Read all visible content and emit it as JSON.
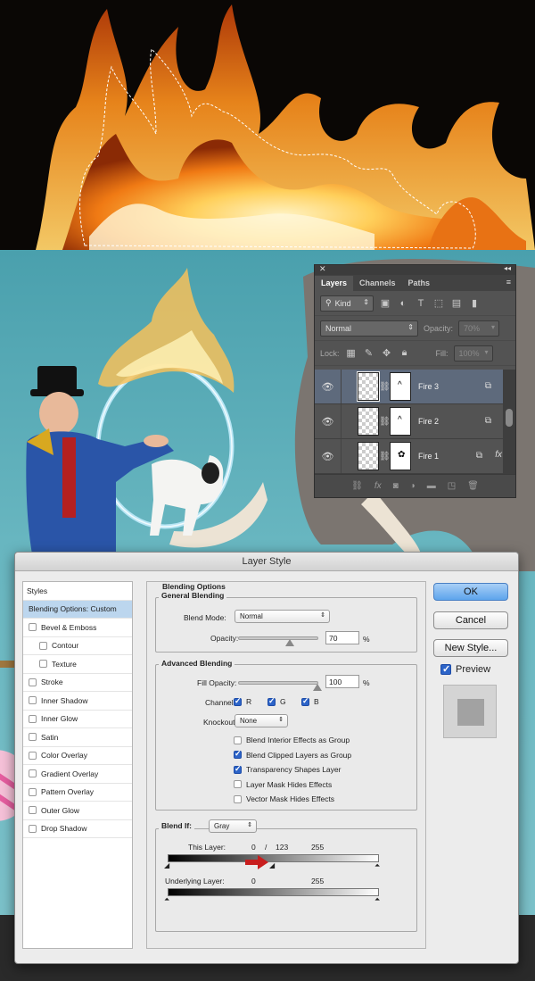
{
  "layers_panel": {
    "tabs": [
      "Layers",
      "Channels",
      "Paths"
    ],
    "filter_kind": "Kind",
    "blend_mode": "Normal",
    "opacity_label": "Opacity:",
    "opacity_value": "70%",
    "lock_label": "Lock:",
    "fill_label": "Fill:",
    "fill_value": "100%",
    "layers": [
      {
        "name": "Fire 3",
        "selected": true
      },
      {
        "name": "Fire 2",
        "selected": false
      },
      {
        "name": "Fire 1",
        "selected": false,
        "fx": "fx"
      }
    ]
  },
  "dialog": {
    "title": "Layer Style",
    "styles": {
      "header": "Styles",
      "selected": "Blending Options: Custom",
      "items": [
        {
          "label": "Bevel & Emboss",
          "sub": false
        },
        {
          "label": "Contour",
          "sub": true
        },
        {
          "label": "Texture",
          "sub": true
        },
        {
          "label": "Stroke",
          "sub": false
        },
        {
          "label": "Inner Shadow",
          "sub": false
        },
        {
          "label": "Inner Glow",
          "sub": false
        },
        {
          "label": "Satin",
          "sub": false
        },
        {
          "label": "Color Overlay",
          "sub": false
        },
        {
          "label": "Gradient Overlay",
          "sub": false
        },
        {
          "label": "Pattern Overlay",
          "sub": false
        },
        {
          "label": "Outer Glow",
          "sub": false
        },
        {
          "label": "Drop Shadow",
          "sub": false
        }
      ]
    },
    "blending": {
      "title": "Blending Options",
      "general_title": "General Blending",
      "blend_mode_label": "Blend Mode:",
      "blend_mode": "Normal",
      "opacity_label": "Opacity:",
      "opacity": "70",
      "opacity_pct": 70,
      "advanced_title": "Advanced Blending",
      "fill_opacity_label": "Fill Opacity:",
      "fill_opacity": "100",
      "fill_opacity_pct": 100,
      "pct_sign": "%",
      "channels_label": "Channels:",
      "channels": [
        "R",
        "G",
        "B"
      ],
      "knockout_label": "Knockout:",
      "knockout": "None",
      "options": [
        {
          "label": "Blend Interior Effects as Group",
          "checked": false
        },
        {
          "label": "Blend Clipped Layers as Group",
          "checked": true
        },
        {
          "label": "Transparency Shapes Layer",
          "checked": true
        },
        {
          "label": "Layer Mask Hides Effects",
          "checked": false
        },
        {
          "label": "Vector Mask Hides Effects",
          "checked": false
        }
      ],
      "blend_if_label": "Blend If:",
      "blend_if": "Gray",
      "this_layer_label": "This Layer:",
      "this_layer_low": "0",
      "this_layer_sep": "/",
      "this_layer_mid": "123",
      "this_layer_high": "255",
      "underlying_label": "Underlying Layer:",
      "underlying_low": "0",
      "underlying_high": "255"
    },
    "buttons": {
      "ok": "OK",
      "cancel": "Cancel",
      "new_style": "New Style...",
      "preview": "Preview"
    }
  },
  "colors": {
    "sky": "#5fb0bb",
    "fire": "#f59a23",
    "panel": "#535353",
    "selection": "#5e6a7c",
    "accent_arrow": "#c81e1e"
  },
  "icons": [
    "close-icon",
    "collapse-icon",
    "panel-menu-icon",
    "eye-icon",
    "link-icon",
    "fx-icon",
    "trash-icon",
    "new-layer-icon",
    "folder-icon",
    "mask-icon",
    "adjustment-icon",
    "red-arrow-icon"
  ]
}
